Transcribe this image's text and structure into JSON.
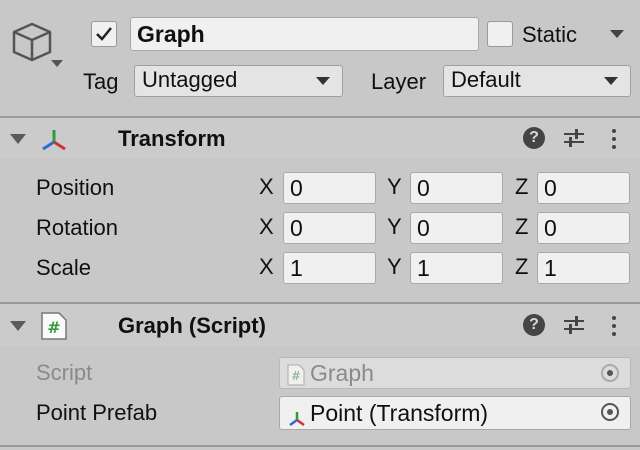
{
  "game_object": {
    "active_checked": true,
    "name": "Graph",
    "static_label": "Static",
    "static_checked": false,
    "tag_label": "Tag",
    "tag_value": "Untagged",
    "layer_label": "Layer",
    "layer_value": "Default"
  },
  "transform": {
    "title": "Transform",
    "rows": [
      {
        "label": "Position",
        "x": "0",
        "y": "0",
        "z": "0"
      },
      {
        "label": "Rotation",
        "x": "0",
        "y": "0",
        "z": "0"
      },
      {
        "label": "Scale",
        "x": "1",
        "y": "1",
        "z": "1"
      }
    ],
    "axis_x": "X",
    "axis_y": "Y",
    "axis_z": "Z"
  },
  "graph_script": {
    "title": "Graph (Script)",
    "script_label": "Script",
    "script_value": "Graph",
    "prefab_label": "Point Prefab",
    "prefab_value": "Point (Transform)"
  },
  "colors": {
    "background": "#c8c8c8",
    "field": "#f0f0f0",
    "axis_red": "#d0332b",
    "axis_green": "#2f9c3a",
    "axis_blue": "#2f6ad0"
  }
}
